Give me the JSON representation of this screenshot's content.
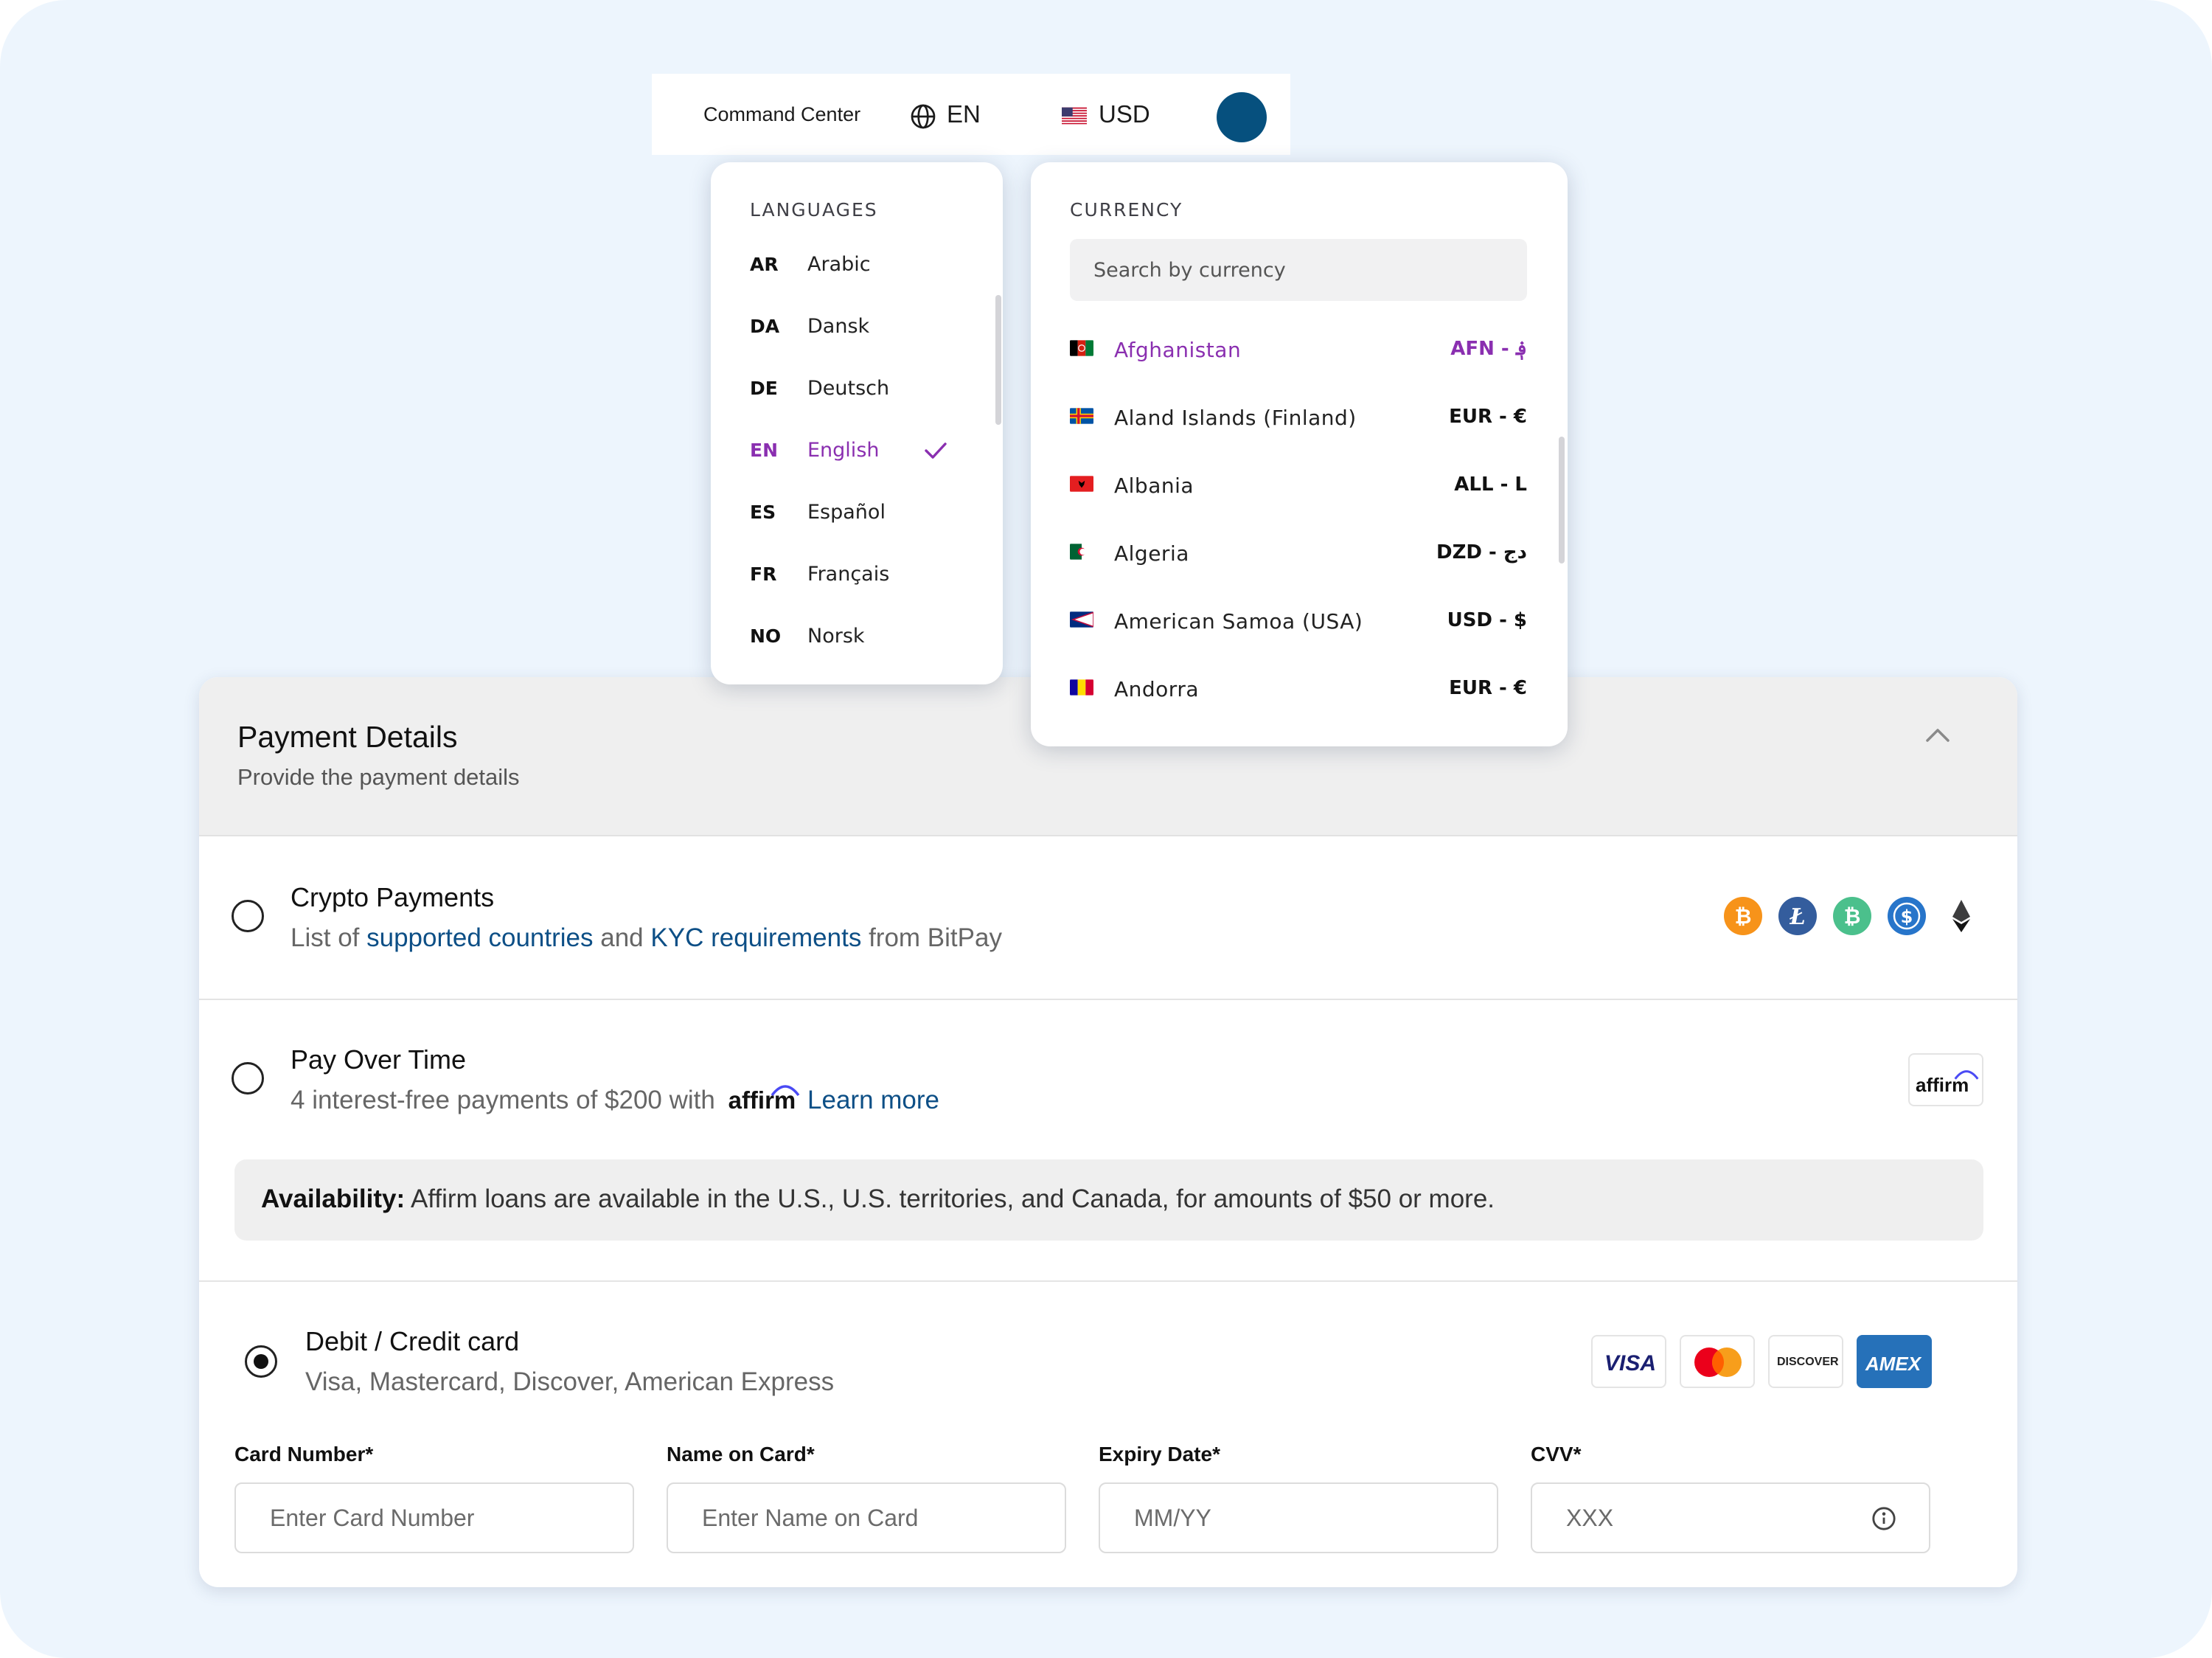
{
  "topbar": {
    "command_center": "Command Center",
    "language": "EN",
    "currency": "USD",
    "avatar_color": "#06507e"
  },
  "languages": {
    "heading": "LANGUAGES",
    "items": [
      {
        "code": "AR",
        "name": "Arabic"
      },
      {
        "code": "DA",
        "name": "Dansk"
      },
      {
        "code": "DE",
        "name": "Deutsch"
      },
      {
        "code": "EN",
        "name": "English",
        "selected": true
      },
      {
        "code": "ES",
        "name": "Español"
      },
      {
        "code": "FR",
        "name": "Français"
      },
      {
        "code": "NO",
        "name": "Norsk"
      }
    ]
  },
  "currency": {
    "heading": "CURRENCY",
    "search_placeholder": "Search by currency",
    "items": [
      {
        "country": "Afghanistan",
        "code": "AFN - ؋",
        "selected": true
      },
      {
        "country": "Aland Islands (Finland)",
        "code": "EUR - €"
      },
      {
        "country": "Albania",
        "code": "ALL - L"
      },
      {
        "country": "Algeria",
        "code": "DZD - دج"
      },
      {
        "country": "American Samoa (USA)",
        "code": "USD - $"
      },
      {
        "country": "Andorra",
        "code": "EUR - €"
      }
    ]
  },
  "payment": {
    "title": "Payment Details",
    "subtitle": "Provide the payment details",
    "crypto": {
      "title": "Crypto Payments",
      "desc_prefix": "List of ",
      "link1": "supported countries",
      "desc_mid": " and ",
      "link2": "KYC requirements",
      "desc_suffix": " from BitPay",
      "icons": [
        "bitcoin-icon",
        "litecoin-icon",
        "bitcoin-cash-icon",
        "usdc-icon",
        "ethereum-icon"
      ]
    },
    "pay_over_time": {
      "title": "Pay Over Time",
      "desc": "4 interest-free payments of $200 with",
      "brand": "affirm",
      "learn_more": "Learn more",
      "availability_label": "Availability:",
      "availability_text": " Affirm loans are available in the U.S., U.S. territories, and Canada, for amounts of $50 or more."
    },
    "card": {
      "title": "Debit / Credit card",
      "desc": "Visa, Mastercard, Discover, American Express",
      "logos": {
        "visa": "VISA",
        "discover": "DISCOVER",
        "amex": "AMEX"
      },
      "fields": {
        "card_number": {
          "label": "Card Number*",
          "placeholder": "Enter Card Number"
        },
        "name": {
          "label": "Name on Card*",
          "placeholder": "Enter Name on Card"
        },
        "expiry": {
          "label": "Expiry Date*",
          "placeholder": "MM/YY"
        },
        "cvv": {
          "label": "CVV*",
          "placeholder": "XXX"
        }
      }
    },
    "selected_method": "card"
  },
  "colors": {
    "accent_purple": "#8a2fb0",
    "link_blue": "#0d4f86",
    "page_bg": "#edf5fd"
  }
}
